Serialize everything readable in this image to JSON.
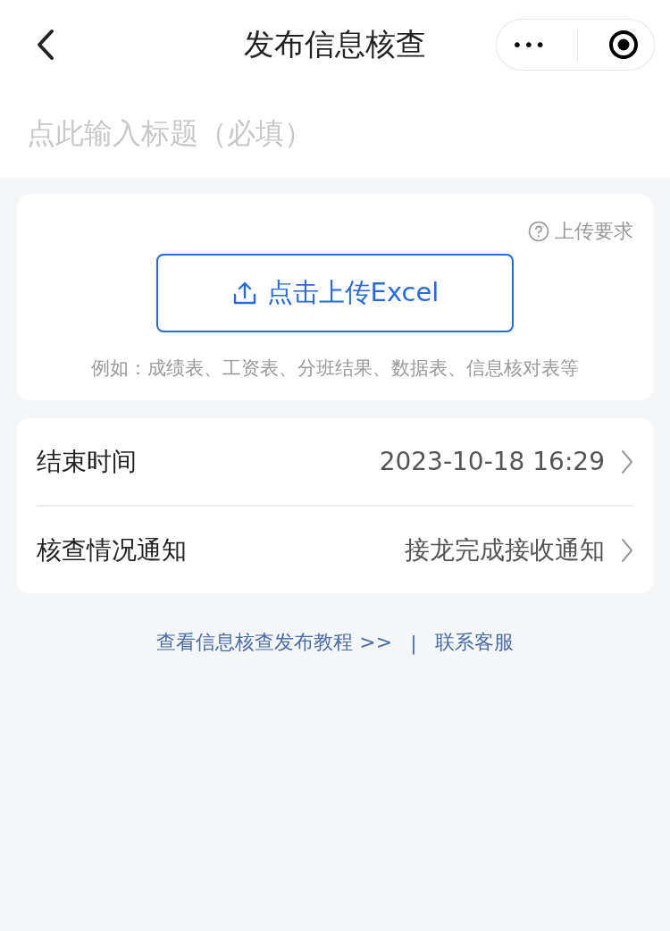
{
  "nav": {
    "title": "发布信息核查",
    "capsule": {
      "more": "•••"
    }
  },
  "title_field": {
    "placeholder": "点此输入标题（必填）"
  },
  "upload": {
    "requirements_link": "上传要求",
    "button": "点击上传Excel",
    "hint": "例如：成绩表、工资表、分班结果、数据表、信息核对表等"
  },
  "settings": [
    {
      "label": "结束时间",
      "value": "2023-10-18 16:29"
    },
    {
      "label": "核查情况通知",
      "value": "接龙完成接收通知"
    }
  ],
  "footer": {
    "links": [
      "查看信息核查发布教程 >>",
      "联系客服"
    ],
    "separator": "|"
  }
}
